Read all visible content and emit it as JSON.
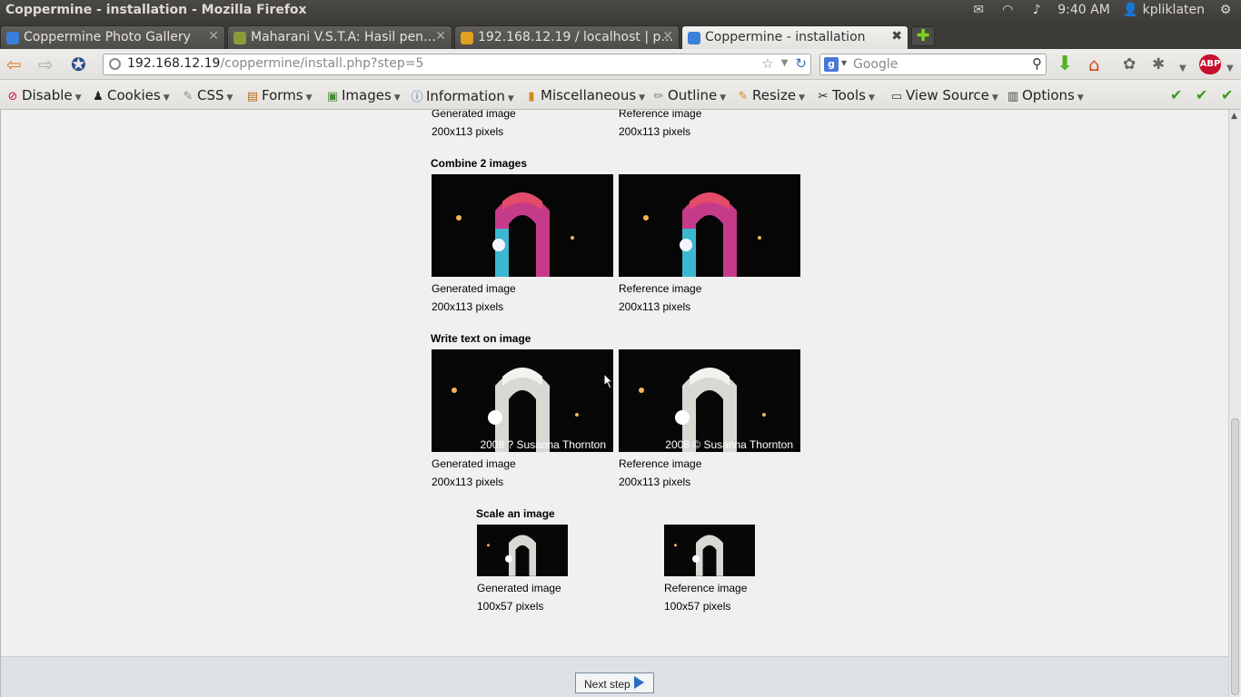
{
  "window": {
    "title": "Coppermine - installation - Mozilla Firefox",
    "clock": "9:40 AM",
    "user": "kpliklaten"
  },
  "tabs": [
    {
      "label": "Coppermine Photo Gallery",
      "active": false
    },
    {
      "label": "Maharani V.S.T.A: Hasil pen…",
      "active": false
    },
    {
      "label": "192.168.12.19 / localhost | p…",
      "active": false
    },
    {
      "label": "Coppermine - installation",
      "active": true
    }
  ],
  "nav": {
    "url_host": "192.168.12.19",
    "url_path": "/coppermine/install.php?step=5",
    "search_placeholder": "Google"
  },
  "devtoolbar": {
    "items": [
      "Disable",
      "Cookies",
      "CSS",
      "Forms",
      "Images",
      "Information",
      "Miscellaneous",
      "Outline",
      "Resize",
      "Tools",
      "View Source",
      "Options"
    ]
  },
  "tests": {
    "top": {
      "generated_label": "Generated image",
      "reference_label": "Reference image",
      "gen_size": "200x113 pixels",
      "ref_size": "200x113 pixels"
    },
    "combine": {
      "title": "Combine 2 images",
      "generated_label": "Generated image",
      "reference_label": "Reference image",
      "gen_size": "200x113 pixels",
      "ref_size": "200x113 pixels"
    },
    "writetext": {
      "title": "Write text on image",
      "generated_label": "Generated image",
      "reference_label": "Reference image",
      "gen_size": "200x113 pixels",
      "ref_size": "200x113 pixels",
      "gen_overlay": "2008 ? Susanna Thornton",
      "ref_overlay": "2008 © Susanna Thornton"
    },
    "scale": {
      "title": "Scale an image",
      "generated_label": "Generated image",
      "reference_label": "Reference image",
      "gen_size": "100x57 pixels",
      "ref_size": "100x57 pixels"
    }
  },
  "footer": {
    "next_label": "Next step"
  },
  "colors": {
    "accent_blue": "#2a6ec7",
    "check_green": "#3a9a1e"
  }
}
